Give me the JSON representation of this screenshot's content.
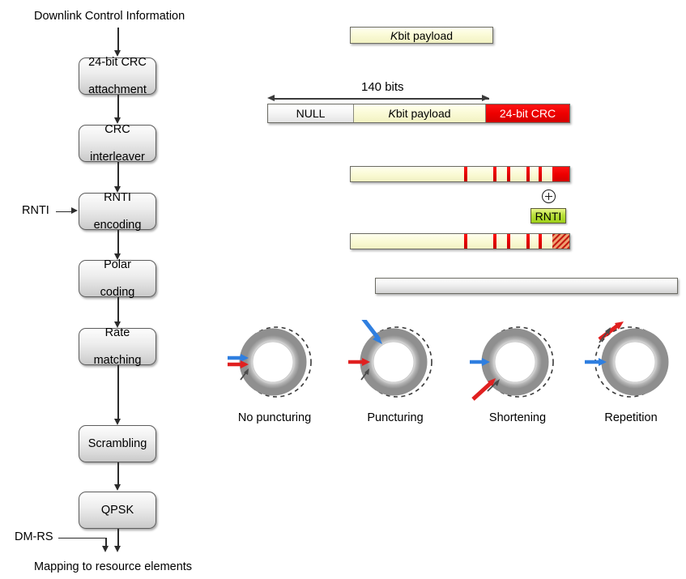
{
  "diagram": {
    "title_flow_input": "Downlink Control Information",
    "flow_output": "Mapping to resource elements",
    "side_inputs": [
      {
        "name": "rnti-input",
        "label": "RNTI"
      },
      {
        "name": "dmrs-input",
        "label": "DM-RS"
      }
    ],
    "blocks": [
      {
        "name": "crc-attachment",
        "line1": "24-bit CRC",
        "line2": "attachment"
      },
      {
        "name": "crc-interleaver",
        "line1": "CRC",
        "line2": "interleaver"
      },
      {
        "name": "rnti-encoding",
        "line1": "RNTI",
        "line2": "encoding"
      },
      {
        "name": "polar-coding",
        "line1": "Polar",
        "line2": "coding"
      },
      {
        "name": "rate-matching",
        "line1": "Rate",
        "line2": "matching"
      },
      {
        "name": "scrambling",
        "line1": "Scrambling",
        "line2": ""
      },
      {
        "name": "qpsk",
        "line1": "QPSK",
        "line2": ""
      }
    ],
    "bars": {
      "payload_bar": {
        "name": "k-bit-payload-bar",
        "segments": [
          {
            "name": "payload-segment",
            "label": "K bit payload",
            "type": "payload"
          }
        ]
      },
      "crc_attached_bar": {
        "name": "crc-attached-bar",
        "dimension_label": "140 bits",
        "segments": [
          {
            "name": "null-segment",
            "label": "NULL",
            "type": "null"
          },
          {
            "name": "payload-segment",
            "label": "K bit payload",
            "type": "payload"
          },
          {
            "name": "crc-segment",
            "label": "24-bit CRC",
            "type": "crc"
          }
        ]
      },
      "interleaved_bar": {
        "name": "interleaved-bar",
        "tail_label": "",
        "tail_type": "crc"
      },
      "scrambled_bar": {
        "name": "rnti-scrambled-bar",
        "tail_label": "",
        "tail_type": "hatched"
      },
      "encoded_bar": {
        "name": "polar-encoded-bar",
        "label": ""
      }
    },
    "rnti_operation": {
      "operator_name": "modulo-add-operator",
      "operator_symbol": "+",
      "operand_label": "RNTI"
    },
    "rate_matching_modes": [
      {
        "name": "no-puncturing",
        "label": "No puncturing"
      },
      {
        "name": "puncturing",
        "label": "Puncturing"
      },
      {
        "name": "shortening",
        "label": "Shortening"
      },
      {
        "name": "repetition",
        "label": "Repetition"
      }
    ],
    "colors": {
      "crc_red": "#ee0000",
      "payload_cream": "#fbfbd8",
      "rnti_green": "#b9e03a",
      "arrow_blue": "#2f7fe0",
      "arrow_red": "#e02020",
      "box_grey": "#e0e0e0"
    }
  }
}
